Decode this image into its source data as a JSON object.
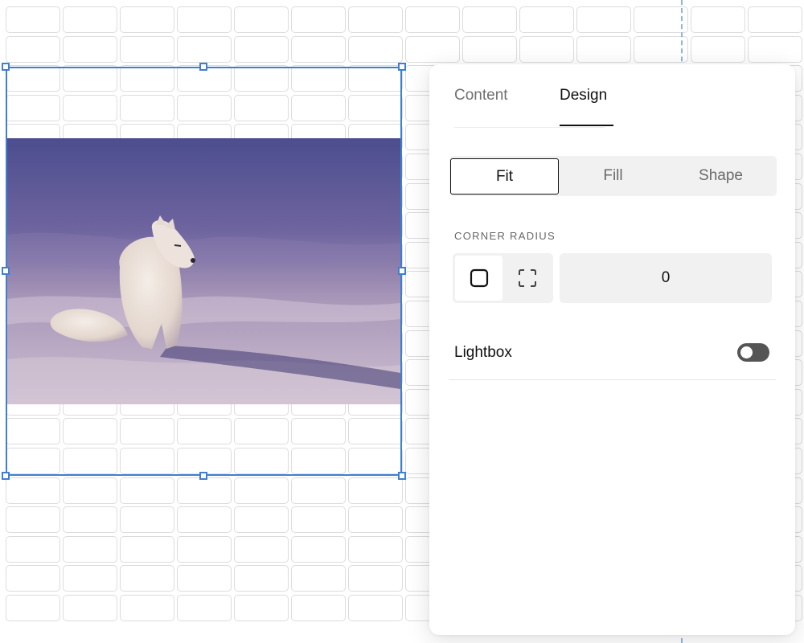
{
  "panel": {
    "tabs": [
      {
        "label": "Content",
        "active": false
      },
      {
        "label": "Design",
        "active": true
      }
    ],
    "fit_mode": {
      "options": [
        "Fit",
        "Fill",
        "Shape"
      ],
      "selected": "Fit"
    },
    "corner_radius": {
      "label": "CORNER RADIUS",
      "modes": [
        "square-corner-icon",
        "individual-corners-icon"
      ],
      "selected_mode": "square-corner-icon",
      "value": "0"
    },
    "lightbox": {
      "label": "Lightbox",
      "enabled": false
    }
  },
  "canvas": {
    "image_icon": "arctic-fox-photo",
    "selection_color": "#3f7fd1",
    "guide_color": "#8fb6e3"
  },
  "colors": {
    "panel_bg": "#ffffff",
    "segment_bg": "#f1f1f1",
    "toggle_off": "#555555",
    "text_primary": "#111111",
    "text_muted": "#6f6f6f"
  }
}
